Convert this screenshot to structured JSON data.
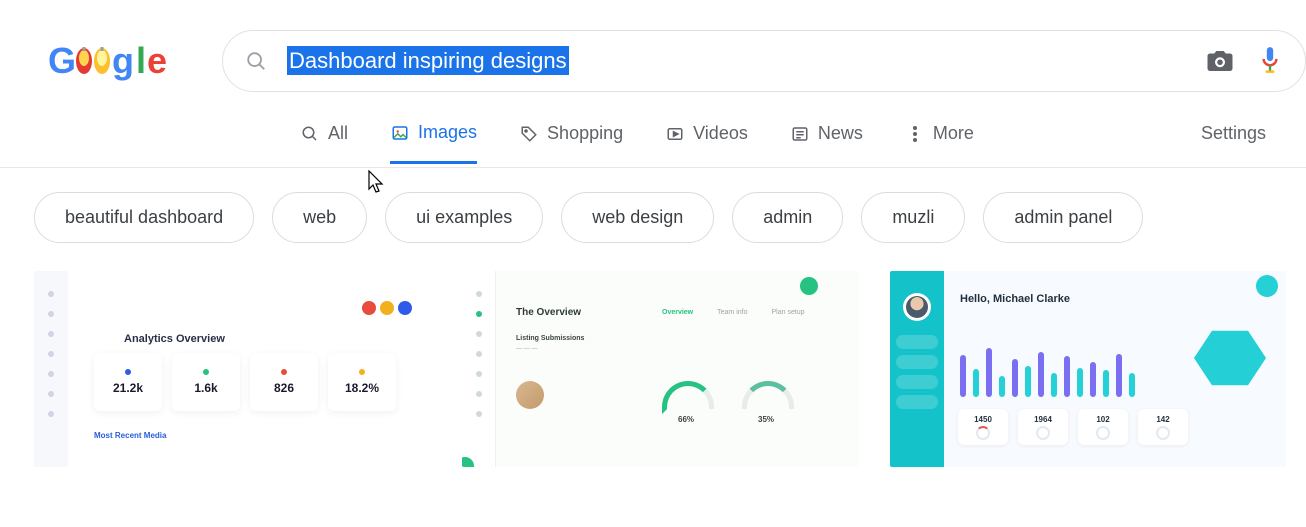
{
  "search": {
    "query": "Dashboard inspiring designs"
  },
  "tabs": {
    "all": "All",
    "images": "Images",
    "shopping": "Shopping",
    "videos": "Videos",
    "news": "News",
    "more": "More",
    "settings": "Settings"
  },
  "chips": [
    "beautiful dashboard",
    "web",
    "ui examples",
    "web design",
    "admin",
    "muzli",
    "admin panel"
  ],
  "thumb1": {
    "heading": "Analytics Overview",
    "cards": [
      {
        "value": "21.2k",
        "dot": "#2f5bea"
      },
      {
        "value": "1.6k",
        "dot": "#26c281"
      },
      {
        "value": "826",
        "dot": "#e74c3c"
      },
      {
        "value": "18.2%",
        "dot": "#f2b01e"
      }
    ],
    "section": "Most Recent Media"
  },
  "thumb2": {
    "title": "The Overview",
    "tabs": [
      "Overview",
      "Team info",
      "Plan setup"
    ],
    "panel_title": "Listing Submissions",
    "gauge1": "66%",
    "gauge2": "35%"
  },
  "thumb3": {
    "greeting": "Hello, Michael Clarke",
    "stats": [
      "1450",
      "1964",
      "102",
      "142"
    ]
  }
}
